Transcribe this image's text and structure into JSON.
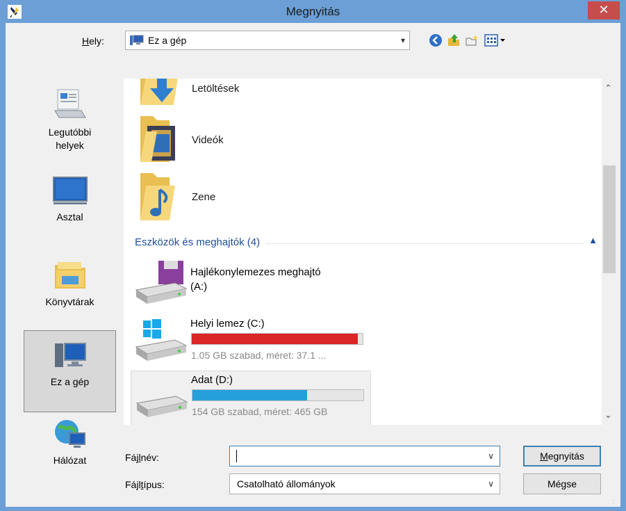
{
  "window": {
    "title": "Megnyitás",
    "close_glyph": "✕",
    "app_icon": "feather-pen-icon"
  },
  "location": {
    "label_prefix": "",
    "label_hotkey": "H",
    "label_rest": "ely:",
    "value": "Ez a gép",
    "toolbar_icons": [
      "back-icon",
      "up-folder-icon",
      "new-folder-icon",
      "view-menu-icon"
    ]
  },
  "places": [
    {
      "label_line1": "Legutóbbi",
      "label_line2": "helyek",
      "icon": "recent-places-icon"
    },
    {
      "label_line1": "Asztal",
      "label_line2": "",
      "icon": "desktop-icon"
    },
    {
      "label_line1": "Könyvtárak",
      "label_line2": "",
      "icon": "libraries-icon"
    },
    {
      "label_line1": "Ez a gép",
      "label_line2": "",
      "icon": "this-pc-icon",
      "selected": true
    },
    {
      "label_line1": "Hálózat",
      "label_line2": "",
      "icon": "network-icon"
    }
  ],
  "folders": [
    {
      "name": "Letöltések",
      "icon": "downloads-folder-icon"
    },
    {
      "name": "Videók",
      "icon": "videos-folder-icon"
    },
    {
      "name": "Zene",
      "icon": "music-folder-icon"
    }
  ],
  "group": {
    "title": "Eszközök és meghajtók (4)"
  },
  "drives": [
    {
      "name_line1": "Hajlékonylemezes meghajtó",
      "name_line2": "(A:)",
      "icon": "floppy-drive-icon"
    },
    {
      "name_line1": "Helyi lemez (C:)",
      "detail": "1.05 GB szabad, méret: 37.1 ...",
      "used_fraction": 0.97,
      "bar_color": "#da2626",
      "icon": "windows-drive-icon"
    },
    {
      "name_line1": "Adat (D:)",
      "detail": "154 GB szabad, méret: 465 GB",
      "used_fraction": 0.67,
      "bar_color": "#26a0da",
      "icon": "hard-drive-icon",
      "selected": true
    }
  ],
  "filename": {
    "label_a": "Fáj",
    "label_hotkey": "l",
    "label_b": "név:",
    "value": ""
  },
  "filetype": {
    "label_a": "Fájl",
    "label_hotkey": "t",
    "label_b": "ípus:",
    "value": "Csatolható állományok"
  },
  "buttons": {
    "open_hotkey": "M",
    "open_rest": "egnyitás",
    "cancel": "Mégse"
  },
  "colors": {
    "titlebar": "#6b9fd6",
    "close": "#c74c4c",
    "group_header": "#1e4e9a",
    "c_drive_bar": "#da2626",
    "d_drive_bar": "#26a0da"
  }
}
